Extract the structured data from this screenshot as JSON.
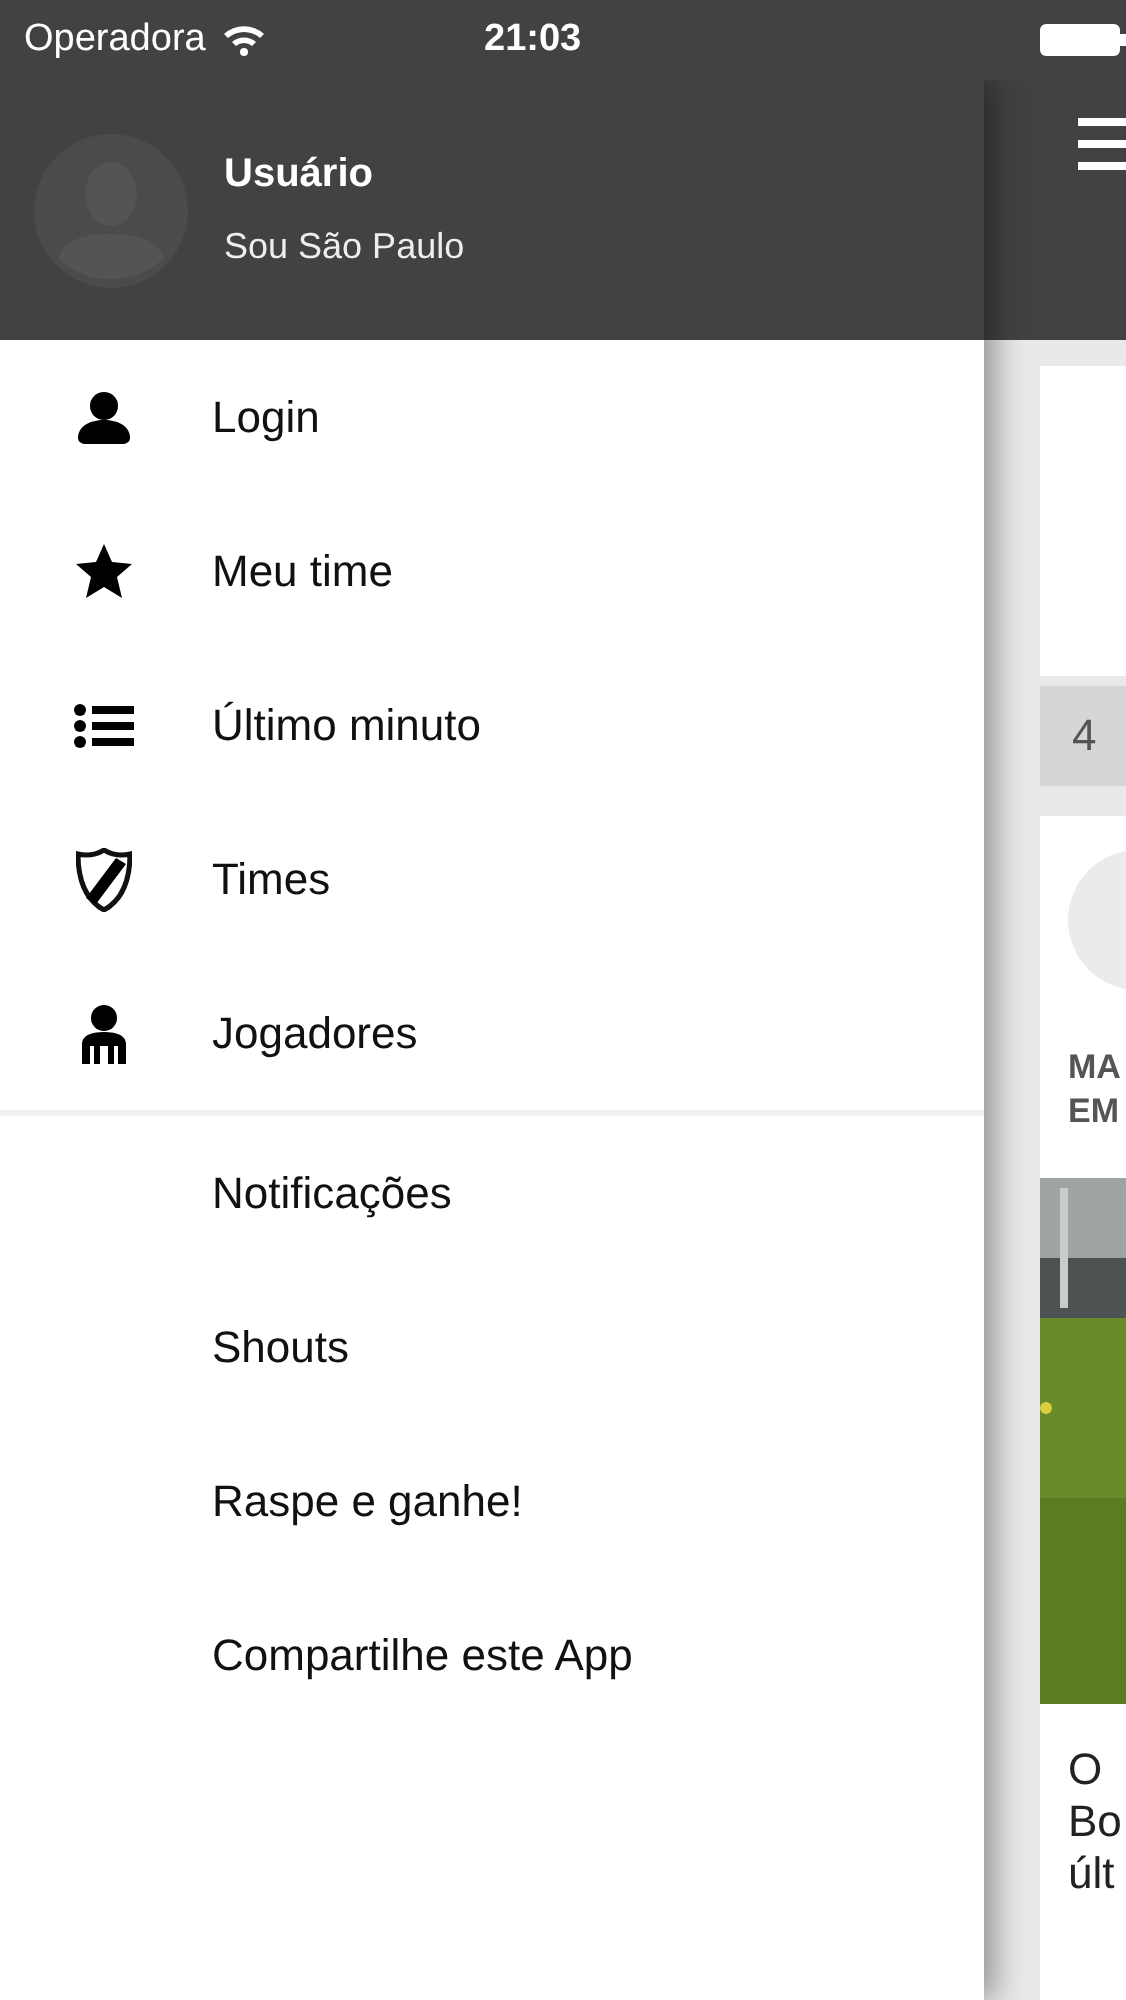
{
  "status_bar": {
    "carrier": "Operadora",
    "time": "21:03"
  },
  "profile": {
    "name": "Usuário",
    "subtitle": "Sou São Paulo"
  },
  "menu_primary": [
    {
      "label": "Login",
      "kind": "person"
    },
    {
      "label": "Meu time",
      "kind": "star"
    },
    {
      "label": "Último minuto",
      "kind": "list"
    },
    {
      "label": "Times",
      "kind": "shield"
    },
    {
      "label": "Jogadores",
      "kind": "player"
    }
  ],
  "menu_secondary": [
    {
      "label": "Notificações"
    },
    {
      "label": "Shouts"
    },
    {
      "label": "Raspe e ganhe!"
    },
    {
      "label": "Compartilhe este App"
    }
  ],
  "background_content": {
    "section_label": "4",
    "headline_lines": [
      "MA",
      "EM"
    ],
    "body_lines": [
      "O",
      "Bo",
      "últ"
    ],
    "image": {
      "kind": "picture"
    }
  }
}
